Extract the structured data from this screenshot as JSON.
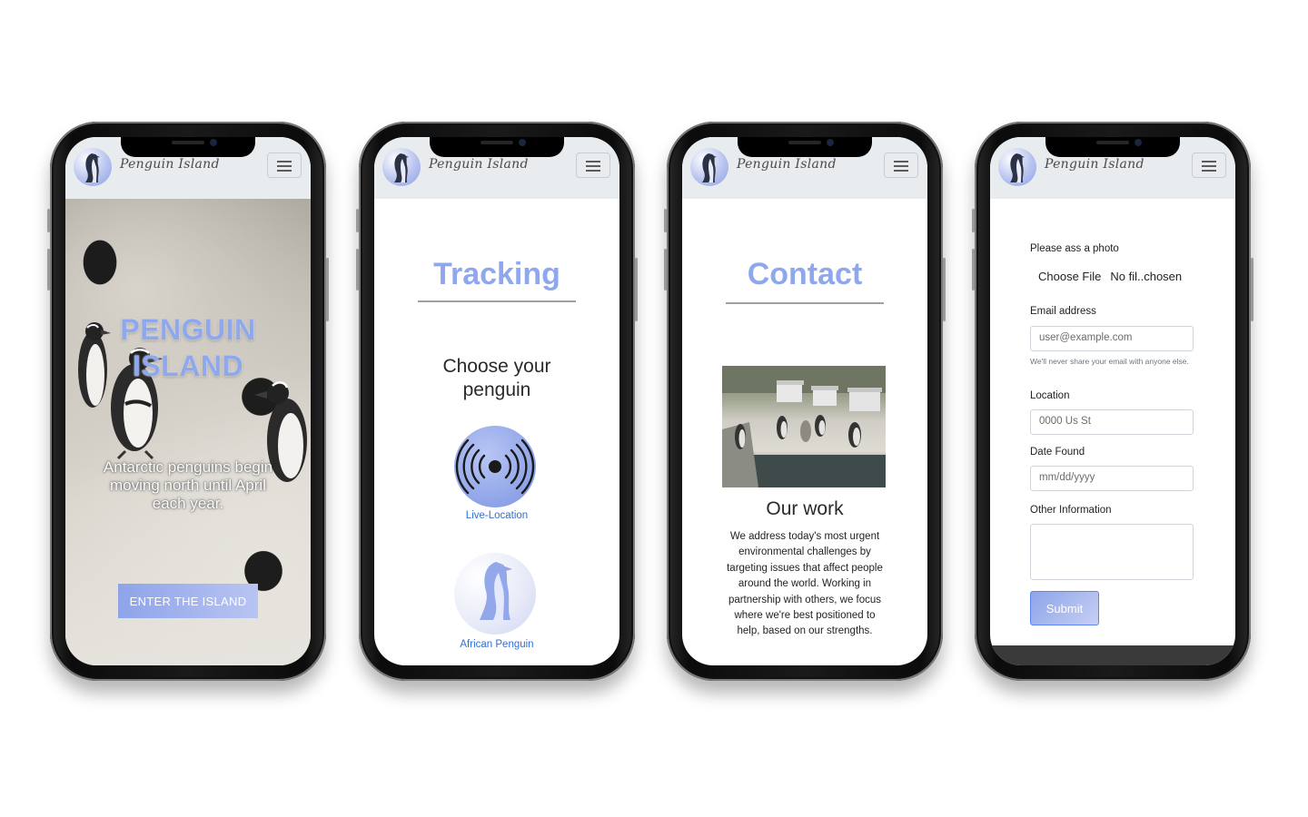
{
  "brand": {
    "name": "Penguin Island"
  },
  "colors": {
    "accent": "#8fa7ec",
    "link": "#2f6fd6",
    "navbar": "#e9ecef"
  },
  "screens": {
    "home": {
      "title": "PENGUIN ISLAND",
      "subtitle": "Antarctic penguins begin moving north until April each year.",
      "cta": "ENTER THE ISLAND"
    },
    "tracking": {
      "heading": "Tracking",
      "prompt": "Choose your penguin",
      "options": [
        {
          "label": "Live-Location",
          "icon": "radar-signal-icon"
        },
        {
          "label": "African Penguin",
          "icon": "penguin-icon"
        }
      ]
    },
    "contact": {
      "heading": "Contact",
      "section_title": "Our work",
      "body": "We address today's most urgent environmental challenges by targeting issues that affect people around the world. Working in partnership with others, we focus where we're best positioned to help, based on our strengths."
    },
    "form": {
      "photo_label": "Please ass a photo",
      "choose_file": "Choose File",
      "file_status": "No fil..chosen",
      "email_label": "Email address",
      "email_placeholder": "user@example.com",
      "email_help": "We'll never share your email with anyone else.",
      "location_label": "Location",
      "location_placeholder": "0000 Us St",
      "date_label": "Date Found",
      "date_placeholder": "mm/dd/yyyy",
      "other_label": "Other Information",
      "submit": "Submit"
    }
  }
}
